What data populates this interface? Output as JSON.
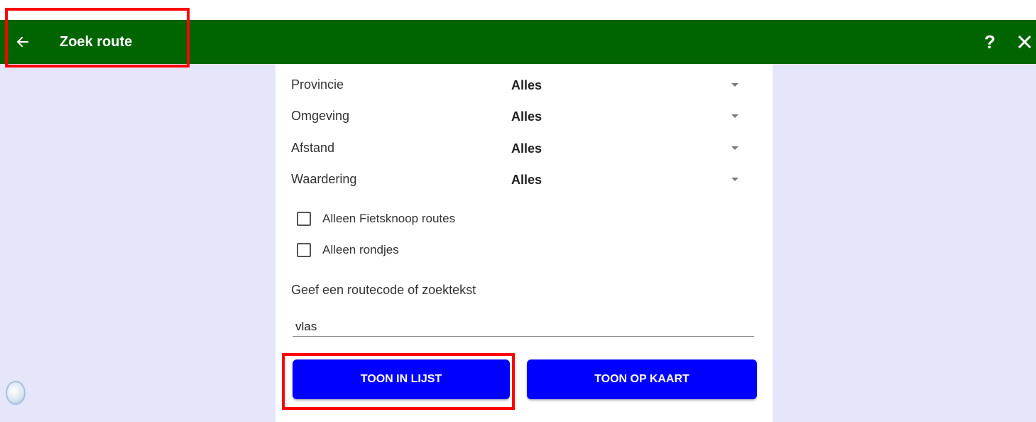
{
  "appbar": {
    "title": "Zoek route",
    "back_icon": "arrow-left-icon",
    "help_label": "?",
    "close_icon": "close-icon",
    "color": "#006400"
  },
  "filters": [
    {
      "label": "Provincie",
      "value": "Alles"
    },
    {
      "label": "Omgeving",
      "value": "Alles"
    },
    {
      "label": "Afstand",
      "value": "Alles"
    },
    {
      "label": "Waardering",
      "value": "Alles"
    }
  ],
  "checkboxes": [
    {
      "label": "Alleen Fietsknoop routes",
      "checked": false
    },
    {
      "label": "Alleen rondjes",
      "checked": false
    }
  ],
  "search": {
    "label": "Geef een routecode of zoektekst",
    "value": "vlas"
  },
  "buttons": {
    "list_label": "TOON IN LIJST",
    "map_label": "TOON OP KAART",
    "color": "#0000ff"
  },
  "colors": {
    "side_panel": "#e6e6fa",
    "highlight": "#ff0000"
  }
}
